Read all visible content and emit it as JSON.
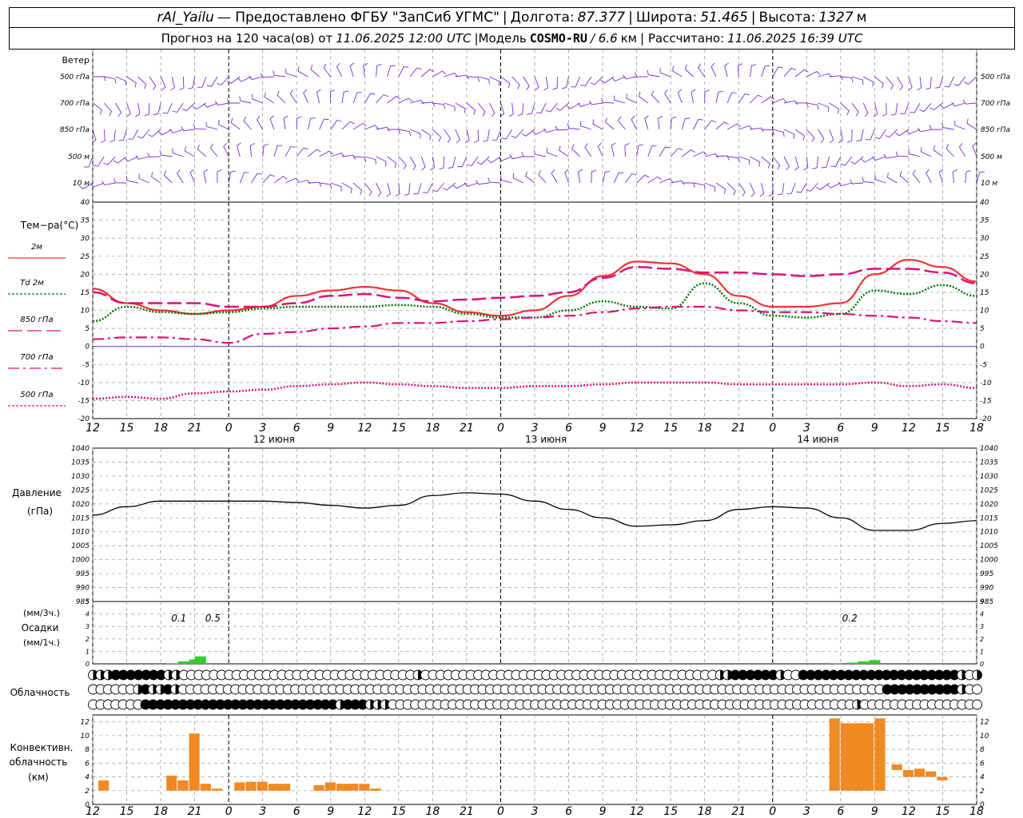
{
  "header": {
    "station": "rAl_Yailu",
    "provider": "— Предоставлено ФГБУ \"ЗапСиб УГМС\"",
    "lon_label": "Долгота:",
    "lon_value": "87.377",
    "lat_label": "Широта:",
    "lat_value": "51.465",
    "alt_label": "Высота:",
    "alt_value": "1327",
    "alt_unit": "м",
    "forecast_prefix": "Прогноз на 120 часа(ов) от",
    "forecast_time": "11.06.2025 12:00 UTC",
    "model_label": "|Модель",
    "model_name": "COSMO-RU",
    "model_res": "/ 6.6",
    "model_res_unit": "км",
    "calc_label": "| Рассчитано:",
    "calc_time": "11.06.2025 16:39 UTC"
  },
  "colors": {
    "t2m": "#ee3333",
    "td2m": "#007700",
    "t850": "#dd1177",
    "t700": "#dd1177",
    "t500": "#dd1177",
    "wind": "#7a2ad8",
    "precip": "#33cc33",
    "convective": "#f08a24",
    "zero_line": "#3333cc"
  },
  "x_axis": {
    "hour_labels": [
      "12",
      "15",
      "18",
      "21",
      "0",
      "3",
      "6",
      "9",
      "12",
      "15",
      "18",
      "21",
      "0",
      "3",
      "6",
      "9",
      "12",
      "15",
      "18",
      "21",
      "0",
      "3",
      "6",
      "9",
      "12",
      "15",
      "18"
    ],
    "day_labels": [
      "12 июня",
      "13 июня",
      "14 июня"
    ]
  },
  "wind_panel": {
    "title": "Ветер",
    "levels": [
      "500 гПа",
      "700 гПа",
      "850 гПа",
      "500 м",
      "10 м"
    ]
  },
  "temperature_panel": {
    "title": "Тем−ра(°C)",
    "legend": [
      {
        "label": "2м",
        "style": "solid",
        "color": "#ee3333"
      },
      {
        "label": "Td 2м",
        "style": "dotted",
        "color": "#007700"
      },
      {
        "label": "850 гПа",
        "style": "long-dash",
        "color": "#dd1177"
      },
      {
        "label": "700 гПа",
        "style": "dash-dot",
        "color": "#dd1177"
      },
      {
        "label": "500 гПа",
        "style": "dense-dot",
        "color": "#dd1177"
      }
    ],
    "ylim": [
      -20,
      40
    ],
    "ticks": [
      40,
      35,
      30,
      25,
      20,
      15,
      10,
      5,
      0,
      -5,
      -10,
      -15,
      -20
    ]
  },
  "pressure_panel": {
    "title": "Давление",
    "unit": "(гПа)",
    "ylim": [
      985,
      1040
    ],
    "ticks": [
      1040,
      1035,
      1030,
      1025,
      1020,
      1015,
      1010,
      1005,
      1000,
      995,
      990,
      985
    ]
  },
  "precip_panel": {
    "unit_top": "(мм/3ч.)",
    "title": "Осадки",
    "unit_bottom": "(мм/1ч.)",
    "ylim": [
      0,
      5
    ],
    "ticks": [
      5,
      4,
      3,
      2,
      1,
      0
    ],
    "annotations": [
      "0.1",
      "0.5",
      "0.2"
    ]
  },
  "cloud_panel": {
    "title": "Облачность"
  },
  "convective_panel": {
    "title1": "Конвективн.",
    "title2": "облачность",
    "unit": "(км)",
    "ylim": [
      0,
      13
    ],
    "ticks": [
      12,
      10,
      8,
      6,
      4,
      2,
      0
    ]
  },
  "chart_data": {
    "type": "line",
    "x_hours": [
      0,
      3,
      6,
      9,
      12,
      15,
      18,
      21,
      24,
      27,
      30,
      33,
      36,
      39,
      42,
      45,
      48,
      51,
      54,
      57,
      60,
      63,
      66,
      69,
      72,
      75,
      78
    ],
    "temperature": {
      "series": [
        {
          "name": "2м",
          "x": [
            0,
            3,
            6,
            9,
            12,
            15,
            18,
            21,
            24,
            27,
            30,
            33,
            36,
            39,
            42,
            45,
            48,
            51,
            54,
            57,
            60,
            63,
            66,
            69,
            72,
            75,
            78
          ],
          "values": [
            16,
            12,
            10,
            9,
            10,
            11,
            14,
            15.5,
            16.5,
            15.5,
            12,
            9.5,
            8.5,
            10,
            14,
            19.5,
            23.5,
            23,
            20,
            14,
            11,
            11,
            12,
            20,
            24,
            22,
            18
          ]
        },
        {
          "name": "Td 2м",
          "x": [
            0,
            3,
            6,
            9,
            12,
            15,
            18,
            21,
            24,
            27,
            30,
            33,
            36,
            39,
            42,
            45,
            48,
            51,
            54,
            57,
            60,
            63,
            66,
            69,
            72,
            75,
            78
          ],
          "values": [
            7,
            11,
            9.5,
            9,
            9.5,
            10.5,
            11,
            11,
            11,
            11.5,
            11,
            9,
            8,
            8,
            10,
            12.5,
            11,
            10.5,
            17.5,
            12,
            8.5,
            8,
            9,
            15.5,
            14.5,
            17,
            14
          ]
        },
        {
          "name": "850 гПа",
          "x": [
            0,
            3,
            6,
            9,
            12,
            15,
            18,
            21,
            24,
            27,
            30,
            33,
            36,
            39,
            42,
            45,
            48,
            51,
            54,
            57,
            60,
            63,
            66,
            69,
            72,
            75,
            78
          ],
          "values": [
            15,
            12,
            12,
            12,
            11,
            11,
            12,
            14,
            14.5,
            13.5,
            12.5,
            13,
            13.5,
            14,
            15,
            19,
            22,
            21.5,
            20.5,
            20.5,
            20,
            19.5,
            20,
            21.5,
            21.5,
            20.5,
            17.5
          ]
        },
        {
          "name": "700 гПа",
          "x": [
            0,
            3,
            6,
            9,
            12,
            15,
            18,
            21,
            24,
            27,
            30,
            33,
            36,
            39,
            42,
            45,
            48,
            51,
            54,
            57,
            60,
            63,
            66,
            69,
            72,
            75,
            78
          ],
          "values": [
            2,
            2.5,
            2.5,
            2,
            1,
            3.5,
            4,
            5,
            5.5,
            6.5,
            6.5,
            7,
            7.5,
            8,
            8.5,
            9.5,
            10.5,
            11,
            11,
            10,
            9.5,
            9.5,
            9,
            8.5,
            8,
            7,
            6.5
          ]
        },
        {
          "name": "500 гПа",
          "x": [
            0,
            3,
            6,
            9,
            12,
            15,
            18,
            21,
            24,
            27,
            30,
            33,
            36,
            39,
            42,
            45,
            48,
            51,
            54,
            57,
            60,
            63,
            66,
            69,
            72,
            75,
            78
          ],
          "values": [
            -14.5,
            -14,
            -14.5,
            -13,
            -12.5,
            -12,
            -11,
            -10.5,
            -10,
            -10.5,
            -11,
            -11.5,
            -11.5,
            -11,
            -11,
            -10.5,
            -10,
            -10,
            -10,
            -10.5,
            -10.5,
            -10.5,
            -10.5,
            -10,
            -11,
            -10.5,
            -11.5
          ]
        }
      ]
    },
    "pressure": {
      "x": [
        0,
        3,
        6,
        9,
        12,
        15,
        18,
        21,
        24,
        27,
        30,
        33,
        36,
        39,
        42,
        45,
        48,
        51,
        54,
        57,
        60,
        63,
        66,
        69,
        72,
        75,
        78
      ],
      "values": [
        1016,
        1019,
        1021,
        1021,
        1021,
        1021,
        1020.5,
        1019.5,
        1018.5,
        1019.5,
        1023,
        1024,
        1023.5,
        1021,
        1018,
        1015,
        1012,
        1012.5,
        1014,
        1018,
        1019,
        1018.5,
        1015,
        1010.5,
        1010.5,
        1013,
        1014
      ]
    },
    "precipitation": {
      "x": [
        6.5,
        7.5,
        8.5,
        9.0,
        65.0,
        66.5,
        67.5,
        68.5
      ],
      "values": [
        0.05,
        0.2,
        0.35,
        0.6,
        0.05,
        0.1,
        0.2,
        0.3
      ]
    },
    "convective_cloud": {
      "bars": [
        {
          "x": 0.5,
          "w": 1,
          "bottom": 2,
          "top": 3.5
        },
        {
          "x": 6.5,
          "w": 1,
          "bottom": 2,
          "top": 4.2
        },
        {
          "x": 7.5,
          "w": 1,
          "bottom": 2,
          "top": 3.5
        },
        {
          "x": 8.5,
          "w": 1,
          "bottom": 2,
          "top": 10.3
        },
        {
          "x": 9.5,
          "w": 1,
          "bottom": 2,
          "top": 3
        },
        {
          "x": 10.5,
          "w": 1,
          "bottom": 2,
          "top": 2.3
        },
        {
          "x": 12.5,
          "w": 1,
          "bottom": 2,
          "top": 3.2
        },
        {
          "x": 13.5,
          "w": 1,
          "bottom": 2,
          "top": 3.3
        },
        {
          "x": 14.5,
          "w": 1,
          "bottom": 2,
          "top": 3.3
        },
        {
          "x": 15.5,
          "w": 2,
          "bottom": 2,
          "top": 3
        },
        {
          "x": 19.5,
          "w": 1,
          "bottom": 2,
          "top": 2.8
        },
        {
          "x": 20.5,
          "w": 1,
          "bottom": 2,
          "top": 3.2
        },
        {
          "x": 21.5,
          "w": 2,
          "bottom": 2,
          "top": 3
        },
        {
          "x": 23.5,
          "w": 1,
          "bottom": 2,
          "top": 3
        },
        {
          "x": 24.5,
          "w": 1,
          "bottom": 2,
          "top": 2.3
        },
        {
          "x": 65.0,
          "w": 1,
          "bottom": 2,
          "top": 12.5
        },
        {
          "x": 66.0,
          "w": 3,
          "bottom": 2,
          "top": 11.8
        },
        {
          "x": 69.0,
          "w": 1,
          "bottom": 2,
          "top": 12.5
        },
        {
          "x": 70.5,
          "w": 1,
          "bottom": 5,
          "top": 5.8
        },
        {
          "x": 71.5,
          "w": 1,
          "bottom": 4,
          "top": 5
        },
        {
          "x": 72.5,
          "w": 1,
          "bottom": 4,
          "top": 5.2
        },
        {
          "x": 73.5,
          "w": 1,
          "bottom": 4,
          "top": 4.8
        },
        {
          "x": 74.5,
          "w": 1,
          "bottom": 3.5,
          "top": 4
        }
      ]
    },
    "cloud_cover": {
      "note": "rows: low, middle, high; values: 0 clear, 0.5 half, 1 overcast",
      "high": [
        0.5,
        0.5,
        0.5,
        1,
        1,
        1,
        1,
        1,
        1,
        1,
        0.5,
        0.5,
        0,
        0,
        0,
        0,
        0,
        0,
        0,
        0,
        0,
        0,
        0,
        0,
        0,
        0,
        0,
        0,
        0,
        0,
        0,
        0,
        0,
        0,
        0,
        0,
        0,
        0,
        0,
        0,
        0,
        0,
        0,
        0.5,
        0,
        0,
        0,
        0,
        0,
        0,
        0,
        0,
        0,
        0,
        0,
        0,
        0,
        0,
        0,
        0,
        0,
        0,
        0,
        0,
        0,
        0,
        0,
        0,
        0,
        0,
        0,
        0,
        0,
        0,
        0,
        0,
        0,
        0,
        0,
        0,
        0,
        0,
        0,
        0.5,
        0.5,
        1,
        1,
        1,
        1,
        1,
        1,
        0.5,
        0,
        0,
        1,
        1,
        1,
        1,
        1,
        1,
        1,
        1,
        1,
        1,
        1,
        1,
        1,
        1,
        1,
        1,
        1,
        1,
        1,
        1,
        1,
        0.5,
        0,
        0.5
      ],
      "middle": [
        0,
        0,
        0,
        0,
        0,
        0,
        0.5,
        1,
        0.5,
        0.5,
        1,
        0.5,
        0,
        0,
        0,
        0,
        0,
        0,
        0,
        0,
        0,
        0,
        0,
        0,
        0,
        0,
        0,
        0,
        0,
        0,
        0,
        0,
        0,
        0,
        0,
        0,
        0,
        0,
        0,
        0,
        0,
        0,
        0,
        0,
        0,
        0,
        0,
        0,
        0,
        0,
        0,
        0,
        0,
        0,
        0,
        0,
        0,
        0,
        0,
        0,
        0,
        0,
        0,
        0,
        0,
        0,
        0,
        0,
        0,
        0,
        0,
        0,
        0,
        0,
        0,
        0,
        0,
        0,
        0,
        0,
        0,
        0,
        0,
        0,
        0,
        0,
        0,
        0,
        0,
        0,
        0,
        0,
        0,
        0,
        0,
        0,
        0,
        0,
        0,
        0,
        0,
        0,
        0,
        0,
        0,
        0,
        1,
        1,
        1,
        1,
        1,
        1,
        1,
        1,
        1,
        1,
        0.5,
        0,
        0
      ],
      "low": [
        0,
        0,
        0,
        0,
        0,
        0,
        0,
        1,
        1,
        1,
        1,
        1,
        1,
        1,
        1,
        1,
        1,
        1,
        1,
        1,
        1,
        1,
        1,
        1,
        1,
        1,
        1,
        1,
        1,
        1,
        1,
        1,
        1,
        0.5,
        1,
        1,
        1,
        0.5,
        0.5,
        0.5,
        0,
        0,
        0,
        0,
        0,
        0,
        0,
        0,
        0,
        0,
        0,
        0,
        0,
        0,
        0,
        0,
        0,
        0,
        0,
        0,
        0,
        0,
        0,
        0,
        0,
        0,
        0,
        0,
        0,
        0,
        0,
        0,
        0,
        0,
        0,
        0,
        0,
        0,
        0,
        0,
        0,
        0,
        0,
        0,
        0,
        0,
        0,
        0,
        0,
        0,
        0,
        0,
        0,
        0,
        0,
        0,
        0,
        0,
        0,
        0,
        0,
        0,
        0.5,
        0,
        0,
        0,
        0,
        0,
        0,
        0,
        0,
        0,
        0,
        0,
        0,
        0,
        0,
        0,
        0
      ]
    }
  }
}
